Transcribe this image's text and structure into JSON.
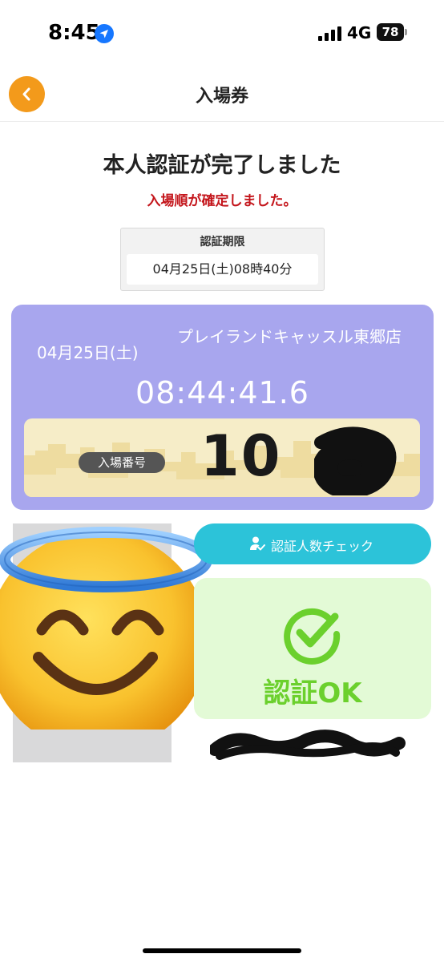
{
  "status_bar": {
    "time": "8:45",
    "network": "4G",
    "battery": "78"
  },
  "nav": {
    "title": "入場券"
  },
  "main": {
    "title": "本人認証が完了しました",
    "message": "入場順が確定しました。",
    "deadline": {
      "label": "認証期限",
      "value": "04月25日(土)08時40分"
    }
  },
  "ticket": {
    "date": "04月25日(土)",
    "store": "プレイランドキャッスル東郷店",
    "clock": "08:44:41.6",
    "entry_label": "入場番号",
    "entry_number_visible": "10"
  },
  "actions": {
    "count_check_label": "認証人数チェック",
    "ok_label": "認証OK"
  },
  "colors": {
    "accent_orange": "#f39a1b",
    "alert_red": "#c4161c",
    "ticket_purple": "#a8a6ee",
    "panel_cream": "#f6edc8",
    "button_cyan": "#2cc3d9",
    "ok_green": "#6bd02d",
    "ok_bg": "#e3fad6"
  },
  "icons": {
    "location": "location-arrow-icon",
    "signal": "signal-bars-icon",
    "back": "chevron-left-icon",
    "person_check": "person-check-icon",
    "ok": "check-circle-icon",
    "emoji": "halo-smiling-face-emoji"
  }
}
